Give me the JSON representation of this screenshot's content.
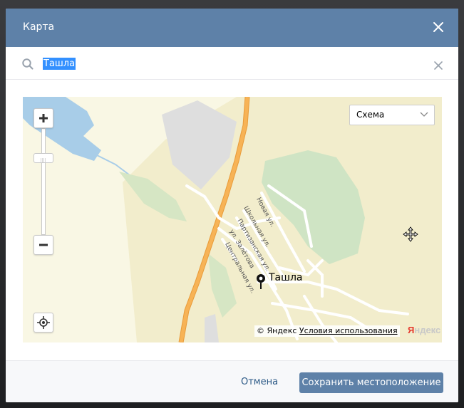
{
  "dialog": {
    "title": "Карта"
  },
  "search": {
    "value": "Ташла"
  },
  "map": {
    "layer_select": "Схема",
    "place_label": "Ташла",
    "streets": [
      "Новая ул.",
      "Школьная ул.",
      "Партизанская ул.",
      "ул. Залётова",
      "Центральная ул."
    ],
    "attribution_copyright": "© Яндекс",
    "attribution_terms": "Условия использования",
    "logo_letter": "Я",
    "logo_rest": "ндекс"
  },
  "footer": {
    "cancel_label": "Отмена",
    "save_label": "Сохранить местоположение"
  },
  "colors": {
    "header": "#5e81a8",
    "primary_button": "#5e81a8",
    "link": "#2a5885",
    "map_background": "#f9f7e4",
    "water": "#a8cde8",
    "forest": "#cfe4c4",
    "road_highway": "#f7b356",
    "selection": "#3390ff"
  }
}
